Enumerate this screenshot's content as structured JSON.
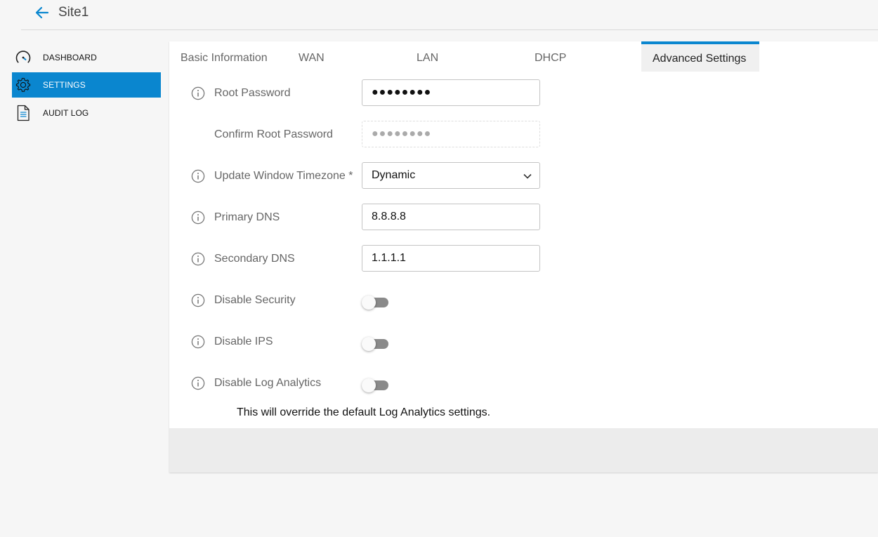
{
  "header": {
    "title": "Site1",
    "back_icon": "arrow-left-icon",
    "accent_color": "#0a86cf"
  },
  "sidebar": {
    "items": [
      {
        "label": "DASHBOARD",
        "icon": "speedometer-icon",
        "active": false
      },
      {
        "label": "SETTINGS",
        "icon": "gear-icon",
        "active": true
      },
      {
        "label": "AUDIT LOG",
        "icon": "document-icon",
        "active": false
      }
    ]
  },
  "tabs": [
    {
      "label": "Basic Information",
      "active": false
    },
    {
      "label": "WAN",
      "active": false
    },
    {
      "label": "LAN",
      "active": false
    },
    {
      "label": "DHCP",
      "active": false
    },
    {
      "label": "Advanced Settings",
      "active": true
    }
  ],
  "form": {
    "root_password": {
      "label": "Root Password",
      "value": "●●●●●●●●"
    },
    "confirm_root_password": {
      "label": "Confirm Root Password",
      "value": "●●●●●●●●"
    },
    "timezone": {
      "label": "Update Window Timezone *",
      "value": "Dynamic"
    },
    "primary_dns": {
      "label": "Primary DNS",
      "value": "8.8.8.8"
    },
    "secondary_dns": {
      "label": "Secondary DNS",
      "value": "1.1.1.1"
    },
    "disable_security": {
      "label": "Disable Security",
      "enabled": false
    },
    "disable_ips": {
      "label": "Disable IPS",
      "enabled": false
    },
    "disable_log_analytics": {
      "label": "Disable Log Analytics",
      "enabled": false
    },
    "log_analytics_note": "This will override the default Log Analytics settings."
  }
}
